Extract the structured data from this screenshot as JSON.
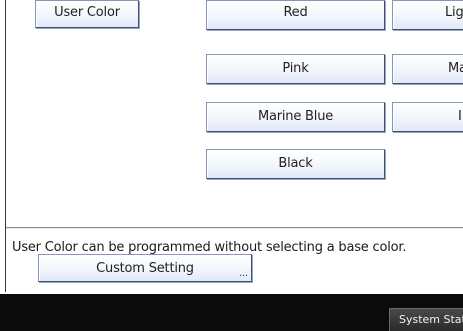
{
  "user_color_button": "User Color",
  "color_buttons": [
    {
      "label": "Red"
    },
    {
      "label": "Ligh"
    },
    {
      "label": "Pink"
    },
    {
      "label": "Ma"
    },
    {
      "label": "Marine Blue"
    },
    {
      "label": "I"
    },
    {
      "label": "Black"
    }
  ],
  "info_text": "User Color can be programmed without selecting a base color.",
  "custom_setting": {
    "label": "Custom Setting",
    "ellipsis": "..."
  },
  "footer": {
    "system_status": "System Statu"
  }
}
